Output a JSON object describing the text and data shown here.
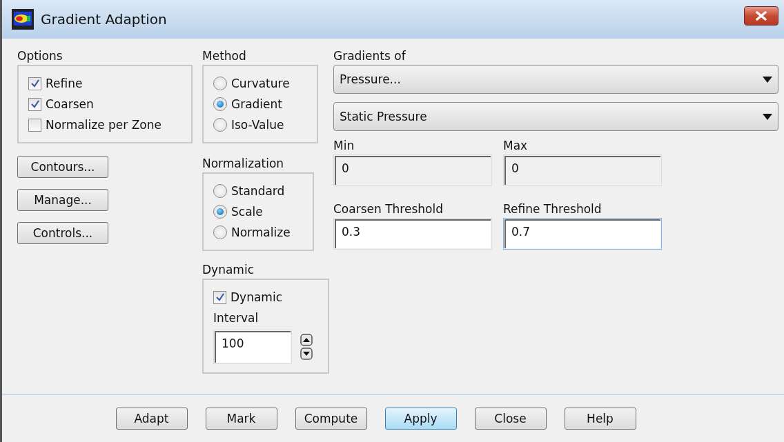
{
  "window": {
    "title": "Gradient Adaption"
  },
  "options": {
    "label": "Options",
    "items": [
      {
        "label": "Refine",
        "checked": true
      },
      {
        "label": "Coarsen",
        "checked": true
      },
      {
        "label": "Normalize per Zone",
        "checked": false
      }
    ]
  },
  "side_buttons": [
    "Contours...",
    "Manage...",
    "Controls..."
  ],
  "method": {
    "label": "Method",
    "items": [
      {
        "label": "Curvature",
        "selected": false
      },
      {
        "label": "Gradient",
        "selected": true
      },
      {
        "label": "Iso-Value",
        "selected": false
      }
    ]
  },
  "normalization": {
    "label": "Normalization",
    "items": [
      {
        "label": "Standard",
        "selected": false
      },
      {
        "label": "Scale",
        "selected": true
      },
      {
        "label": "Normalize",
        "selected": false
      }
    ]
  },
  "dynamic": {
    "label": "Dynamic",
    "checkbox": {
      "label": "Dynamic",
      "checked": true
    },
    "interval": {
      "label": "Interval",
      "value": "100"
    }
  },
  "gradients_of": {
    "label": "Gradients of",
    "dropdowns": [
      "Pressure...",
      "Static Pressure"
    ]
  },
  "fields": [
    {
      "label": "Min",
      "value": "0",
      "disabled": true,
      "focused": false
    },
    {
      "label": "Max",
      "value": "0",
      "disabled": true,
      "focused": false
    },
    {
      "label": "Coarsen Threshold",
      "value": "0.3",
      "disabled": false,
      "focused": false
    },
    {
      "label": "Refine Threshold",
      "value": "0.7",
      "disabled": false,
      "focused": true
    }
  ],
  "footer_buttons": [
    {
      "label": "Adapt",
      "default": false
    },
    {
      "label": "Mark",
      "default": false
    },
    {
      "label": "Compute",
      "default": false
    },
    {
      "label": "Apply",
      "default": true
    },
    {
      "label": "Close",
      "default": false
    },
    {
      "label": "Help",
      "default": false
    }
  ]
}
